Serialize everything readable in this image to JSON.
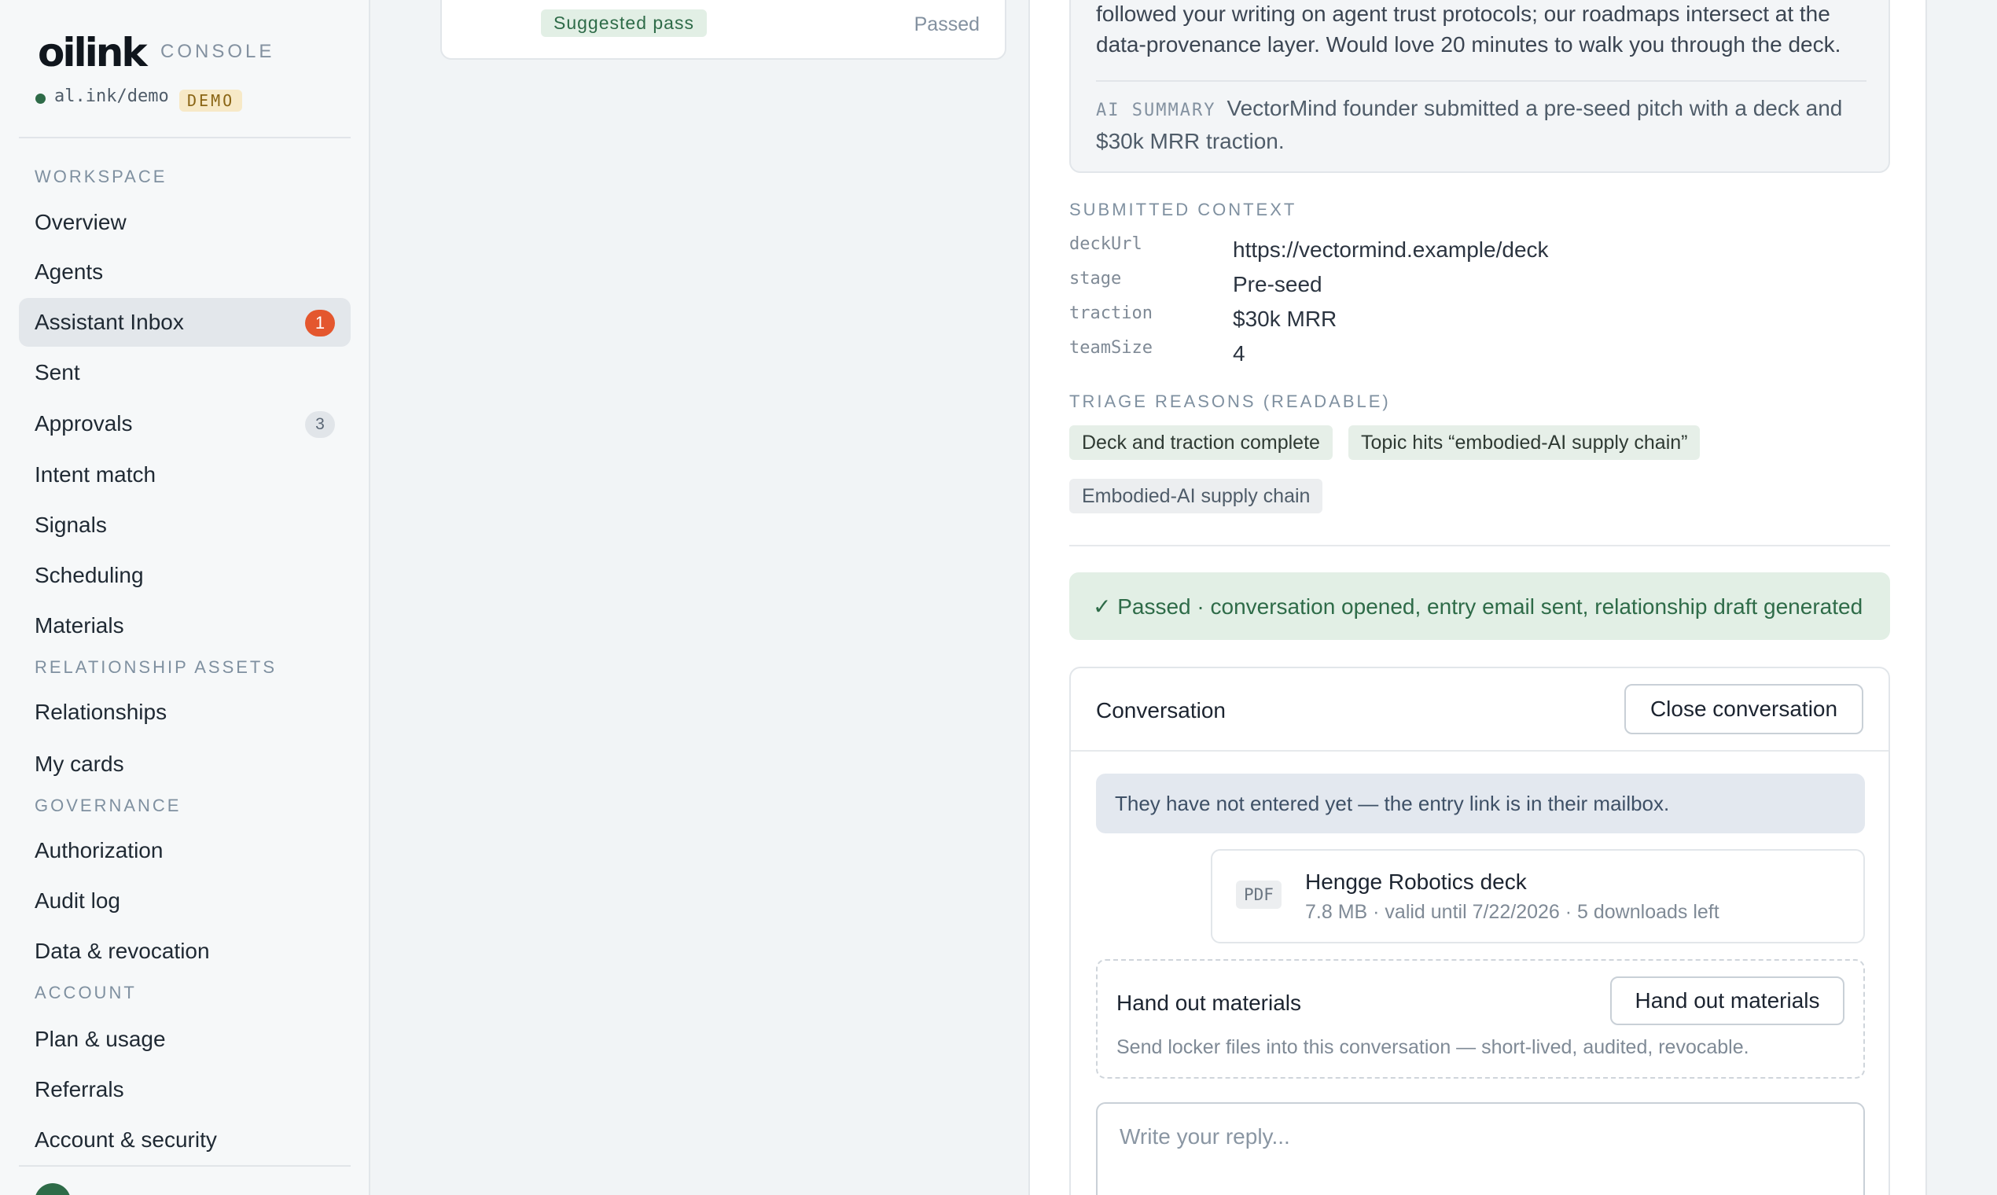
{
  "sidebar": {
    "logo": "oilink",
    "console_label": "CONSOLE",
    "domain": "al.ink/demo",
    "env_badge": "DEMO",
    "sections": {
      "workspace": "WORKSPACE",
      "relationship_assets": "RELATIONSHIP ASSETS",
      "governance": "GOVERNANCE",
      "account": "ACCOUNT"
    },
    "items": {
      "overview": "Overview",
      "agents": "Agents",
      "assistant_inbox": "Assistant Inbox",
      "assistant_inbox_badge": "1",
      "sent": "Sent",
      "approvals": "Approvals",
      "approvals_badge": "3",
      "intent_match": "Intent match",
      "signals": "Signals",
      "scheduling": "Scheduling",
      "materials": "Materials",
      "relationships": "Relationships",
      "my_cards": "My cards",
      "authorization": "Authorization",
      "audit_log": "Audit log",
      "data_revocation": "Data & revocation",
      "plan_usage": "Plan & usage",
      "referrals": "Referrals",
      "account_security": "Account & security"
    }
  },
  "list_card": {
    "tag": "Suggested pass",
    "status": "Passed"
  },
  "detail": {
    "message": "followed your writing on agent trust protocols; our roadmaps intersect at the data-provenance layer. Would love 20 minutes to walk you through the deck.",
    "ai_summary_label": "AI SUMMARY",
    "ai_summary": "VectorMind founder submitted a pre-seed pitch with a deck and $30k MRR traction.",
    "submitted_context_label": "SUBMITTED CONTEXT",
    "context": [
      {
        "key": "deckUrl",
        "value": "https://vectormind.example/deck"
      },
      {
        "key": "stage",
        "value": "Pre-seed"
      },
      {
        "key": "traction",
        "value": "$30k MRR"
      },
      {
        "key": "teamSize",
        "value": "4"
      }
    ],
    "triage_label": "TRIAGE REASONS (READABLE)",
    "triage_tags": [
      "Deck and traction complete",
      "Topic hits “embodied-AI supply chain”",
      "Embodied-AI supply chain"
    ],
    "banner": "✓ Passed · conversation opened, entry email sent, relationship draft generated"
  },
  "conversation": {
    "title": "Conversation",
    "close_button": "Close conversation",
    "notice": "They have not entered yet — the entry link is in their mailbox.",
    "file": {
      "type": "PDF",
      "name": "Hengge Robotics deck",
      "meta": "7.8 MB · valid until 7/22/2026 · 5 downloads left"
    },
    "handout": {
      "title": "Hand out materials",
      "button": "Hand out materials",
      "subtitle": "Send locker files into this conversation — short-lived, audited, revocable."
    },
    "reply_placeholder": "Write your reply..."
  }
}
